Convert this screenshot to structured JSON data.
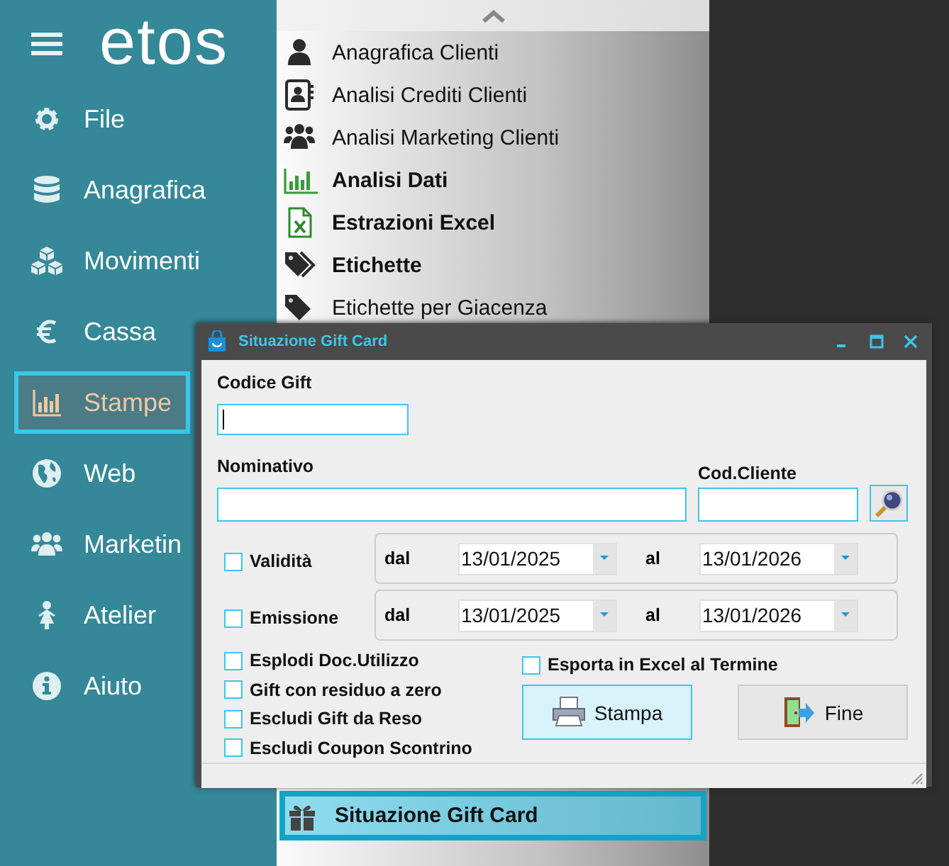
{
  "sidebar": {
    "logo": "etos",
    "items": [
      {
        "label": "File",
        "selected": false
      },
      {
        "label": "Anagrafica",
        "selected": false
      },
      {
        "label": "Movimenti",
        "selected": false
      },
      {
        "label": "Cassa",
        "selected": false
      },
      {
        "label": "Stampe",
        "selected": true
      },
      {
        "label": "Web",
        "selected": false
      },
      {
        "label": "Marketin",
        "selected": false
      },
      {
        "label": "Atelier",
        "selected": false
      },
      {
        "label": "Aiuto",
        "selected": false
      }
    ]
  },
  "menu": {
    "items": [
      {
        "label": "Anagrafica Clienti",
        "bold": false,
        "selected": false
      },
      {
        "label": "Analisi Crediti Clienti",
        "bold": false,
        "selected": false
      },
      {
        "label": "Analisi Marketing Clienti",
        "bold": false,
        "selected": false
      },
      {
        "label": "Analisi Dati",
        "bold": true,
        "selected": false
      },
      {
        "label": "Estrazioni Excel",
        "bold": true,
        "selected": false
      },
      {
        "label": "Etichette",
        "bold": true,
        "selected": false
      },
      {
        "label": "Etichette per Giacenza",
        "bold": false,
        "selected": false
      }
    ],
    "bottom_items": [
      {
        "label": "Situazione Gift Card",
        "bold": true,
        "selected": true
      }
    ]
  },
  "dialog": {
    "title": "Situazione Gift Card",
    "codice_gift": {
      "label": "Codice Gift",
      "focused": true
    },
    "nominativo": {
      "label": "Nominativo"
    },
    "cod_cliente": {
      "label": "Cod.Cliente"
    },
    "date_ranges": [
      {
        "label": "Validità",
        "checked": false,
        "from_label": "dal",
        "from": "13/01/2025",
        "to_label": "al",
        "to": "13/01/2026"
      },
      {
        "label": "Emissione",
        "checked": false,
        "from_label": "dal",
        "from": "13/01/2025",
        "to_label": "al",
        "to": "13/01/2026"
      }
    ],
    "options": [
      {
        "label": "Esplodi Doc.Utilizzo",
        "checked": false
      },
      {
        "label": "Gift con residuo a zero",
        "checked": false
      },
      {
        "label": "Escludi Gift da Reso",
        "checked": false
      },
      {
        "label": "Escludi Coupon Scontrino",
        "checked": false
      }
    ],
    "export": {
      "label": "Esporta in Excel al Termine",
      "checked": false
    },
    "buttons": [
      {
        "label": "Stampa",
        "default": true
      },
      {
        "label": "Fine",
        "default": false
      }
    ]
  }
}
